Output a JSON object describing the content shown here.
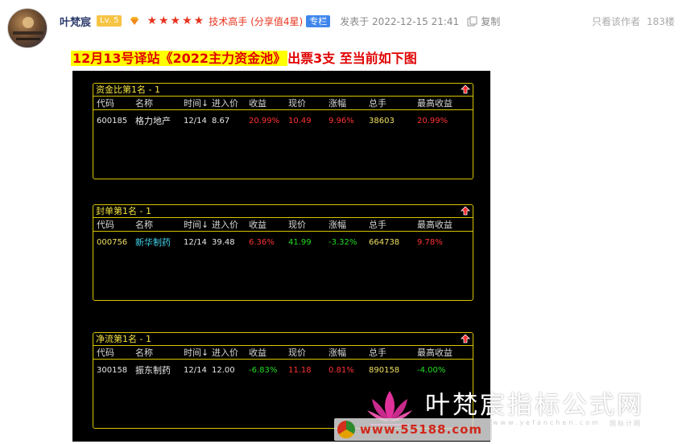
{
  "post": {
    "username": "叶梵宸",
    "level": "Lv. 5",
    "stars": "★★★★★",
    "rank": "技术高手",
    "rank_score": "(分享值4星)",
    "column_badge": "专栏",
    "posted_at": "发表于 2022-12-15 21:41",
    "copy_label": "复制",
    "author_only": "只看该作者",
    "floor": "183楼",
    "headline_highlight": "12月13号译站《2022主力资金池》",
    "headline_rest": "出票3支 至当前如下图"
  },
  "colors": {
    "accent_red": "#e8321d",
    "badge_blue": "#3f86ec",
    "grid_border": "#d7c400",
    "up": "#ff3333",
    "down": "#22dd22",
    "volume": "#f0e060"
  },
  "grids": [
    {
      "title": "资金比第1名 - 1",
      "columns": [
        "代码",
        "名称",
        "时间↓",
        "进入价",
        "收益",
        "现价",
        "涨幅",
        "总手",
        "最高收益"
      ],
      "row": {
        "code": "600185",
        "name": "格力地产",
        "time": "12/14",
        "entry": "8.67",
        "profit": "20.99%",
        "price": "10.49",
        "change": "9.96%",
        "volume": "38603",
        "max_profit": "20.99%"
      }
    },
    {
      "title": "封单第1名 - 1",
      "columns": [
        "代码",
        "名称",
        "时间↓",
        "进入价",
        "收益",
        "现价",
        "涨幅",
        "总手",
        "最高收益"
      ],
      "row": {
        "code": "000756",
        "name": "新华制药",
        "time": "12/14",
        "entry": "39.48",
        "profit": "6.36%",
        "price": "41.99",
        "change": "-3.32%",
        "volume": "664738",
        "max_profit": "9.78%"
      }
    },
    {
      "title": "净流第1名 - 1",
      "columns": [
        "代码",
        "名称",
        "时间↓",
        "进入价",
        "收益",
        "现价",
        "涨幅",
        "总手",
        "最高收益"
      ],
      "row": {
        "code": "300158",
        "name": "振东制药",
        "time": "12/14",
        "entry": "12.00",
        "profit": "-6.83%",
        "price": "11.18",
        "change": "0.81%",
        "volume": "890158",
        "max_profit": "-4.00%"
      }
    }
  ],
  "watermark": {
    "brand": "叶梵宸指标公式网",
    "url": "www.yefanchen.com",
    "sub": "国标计网",
    "site": "www.55188.com"
  }
}
